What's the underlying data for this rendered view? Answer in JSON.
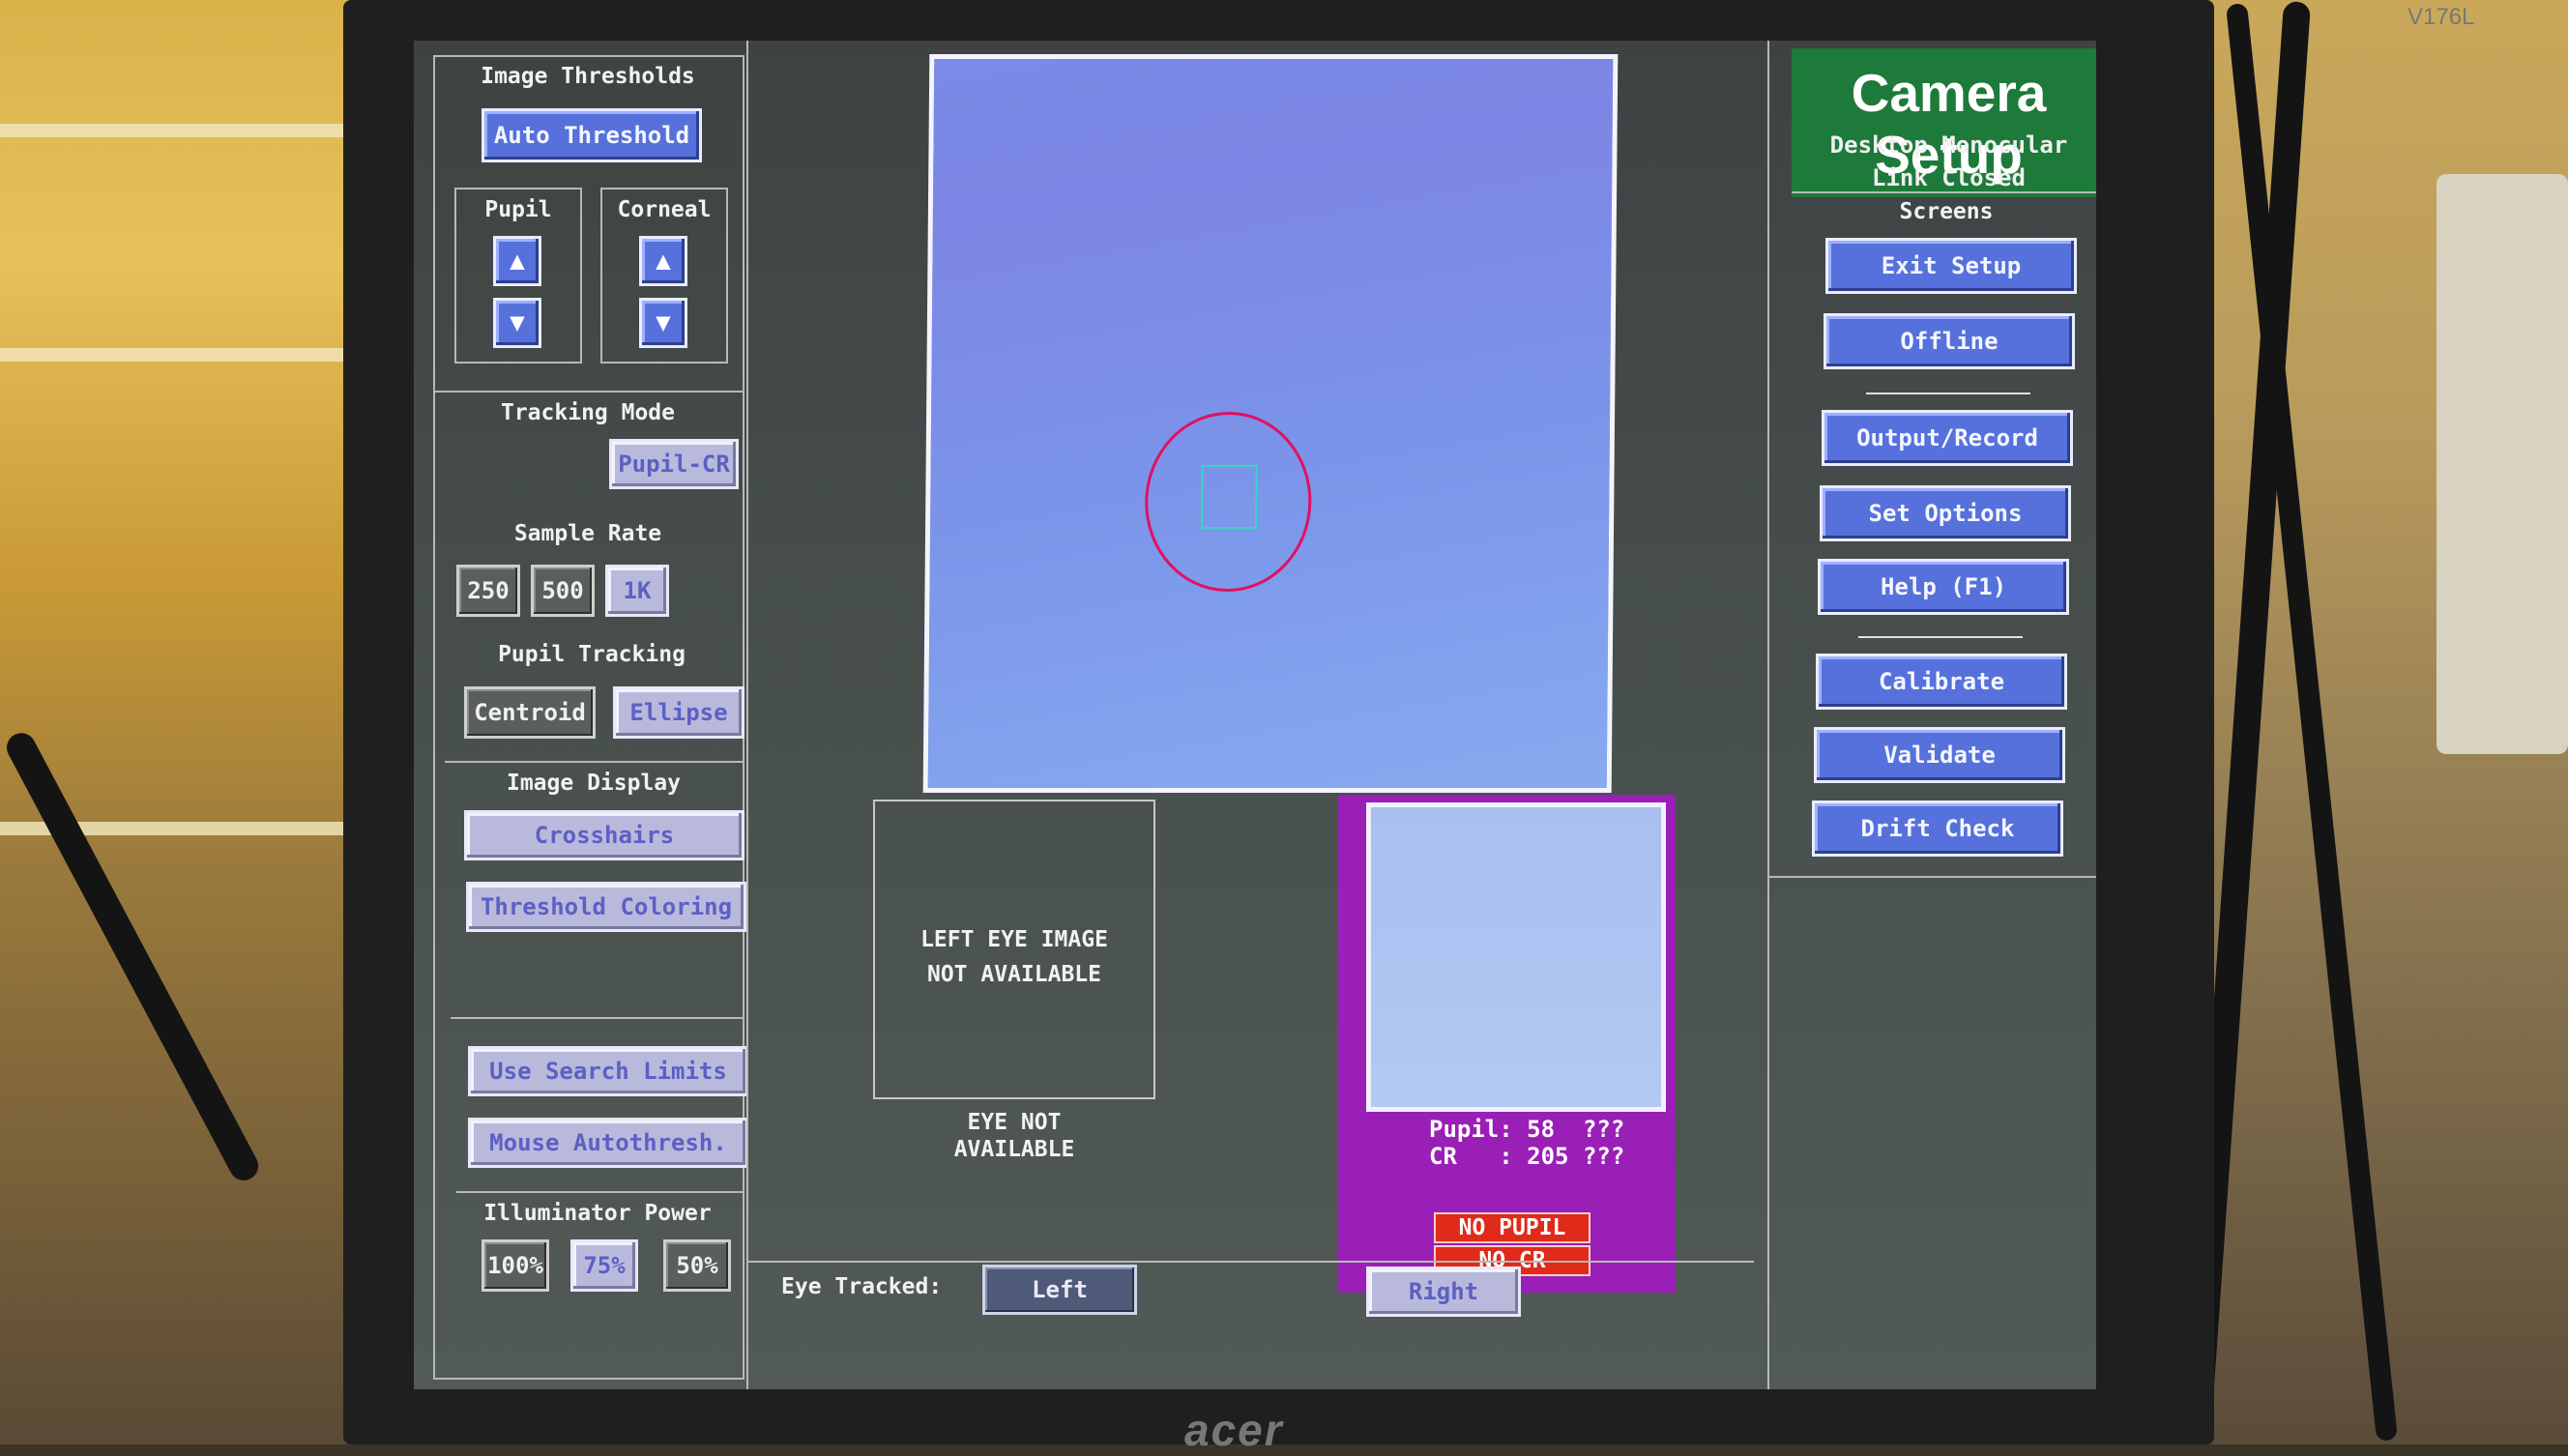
{
  "monitor": {
    "model": "V176L",
    "brand": "acer"
  },
  "header": {
    "title": "Camera Setup",
    "mode": "Desktop Monocular",
    "link_status": "Link Closed"
  },
  "thresholds": {
    "title": "Image Thresholds",
    "auto_button": "Auto Threshold",
    "pupil_label": "Pupil",
    "corneal_label": "Corneal"
  },
  "tracking_mode": {
    "title": "Tracking Mode",
    "value": "Pupil-CR"
  },
  "sample_rate": {
    "title": "Sample Rate",
    "options": [
      "250",
      "500",
      "1K"
    ],
    "selected": "1K"
  },
  "pupil_tracking": {
    "title": "Pupil Tracking",
    "options": [
      "Centroid",
      "Ellipse"
    ],
    "selected": "Ellipse"
  },
  "image_display": {
    "title": "Image Display",
    "buttons": [
      "Crosshairs",
      "Threshold Coloring"
    ]
  },
  "search": {
    "buttons": [
      "Use Search Limits",
      "Mouse Autothresh."
    ]
  },
  "illuminator": {
    "title": "Illuminator Power",
    "options": [
      "100%",
      "75%",
      "50%"
    ],
    "selected": "75%"
  },
  "left_eye": {
    "image_msg_1": "LEFT EYE IMAGE",
    "image_msg_2": "NOT AVAILABLE",
    "status_1": "EYE NOT",
    "status_2": "AVAILABLE"
  },
  "right_eye": {
    "pupil_line": "Pupil: 58  ???",
    "cr_line": "CR   : 205 ???",
    "no_pupil": "NO PUPIL",
    "no_cr": "NO  CR"
  },
  "eye_tracked": {
    "label": "Eye Tracked:",
    "left": "Left",
    "right": "Right",
    "selected": "Left"
  },
  "screens": {
    "title": "Screens",
    "group1": [
      "Exit Setup",
      "Offline"
    ],
    "group2": [
      "Output/Record",
      "Set Options",
      "Help (F1)"
    ],
    "group3": [
      "Calibrate",
      "Validate",
      "Drift Check"
    ]
  },
  "colors": {
    "button_blue": "#5671db",
    "header_green": "#1e7a3a",
    "eye_panel_purple": "#9a1fb6",
    "warning_red": "#e02a1a"
  }
}
